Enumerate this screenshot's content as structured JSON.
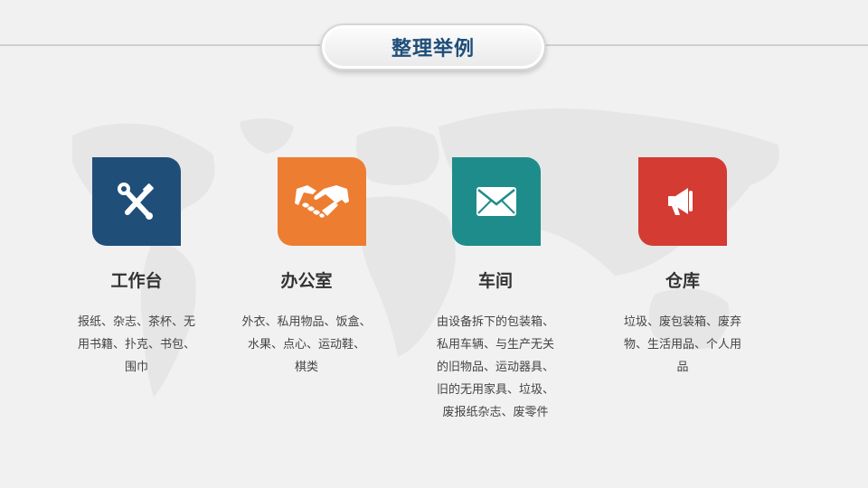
{
  "title": "整理举例",
  "colors": {
    "title_text": "#1f4e79",
    "navy": "#1f4e79",
    "orange": "#ed7d31",
    "teal": "#1e8c8a",
    "red": "#d33b33",
    "background": "#f1f1f1"
  },
  "cards": [
    {
      "icon": "tools-icon",
      "color": "#1f4e79",
      "title": "工作台",
      "lines": [
        "报纸、杂志、茶杯、无",
        "用书籍、扑克、书包、",
        "围巾"
      ]
    },
    {
      "icon": "handshake-icon",
      "color": "#ed7d31",
      "title": "办公室",
      "lines": [
        "外衣、私用物品、饭盒、",
        "水果、点心、运动鞋、",
        "棋类"
      ]
    },
    {
      "icon": "envelope-icon",
      "color": "#1e8c8a",
      "title": "车间",
      "lines": [
        "由设备拆下的包装箱、",
        "私用车辆、与生产无关",
        "的旧物品、运动器具、",
        "旧的无用家具、垃圾、",
        "废报纸杂志、废零件"
      ]
    },
    {
      "icon": "megaphone-icon",
      "color": "#d33b33",
      "title": "仓库",
      "lines": [
        "垃圾、废包装箱、废弃",
        "物、生活用品、个人用",
        "品"
      ]
    }
  ]
}
